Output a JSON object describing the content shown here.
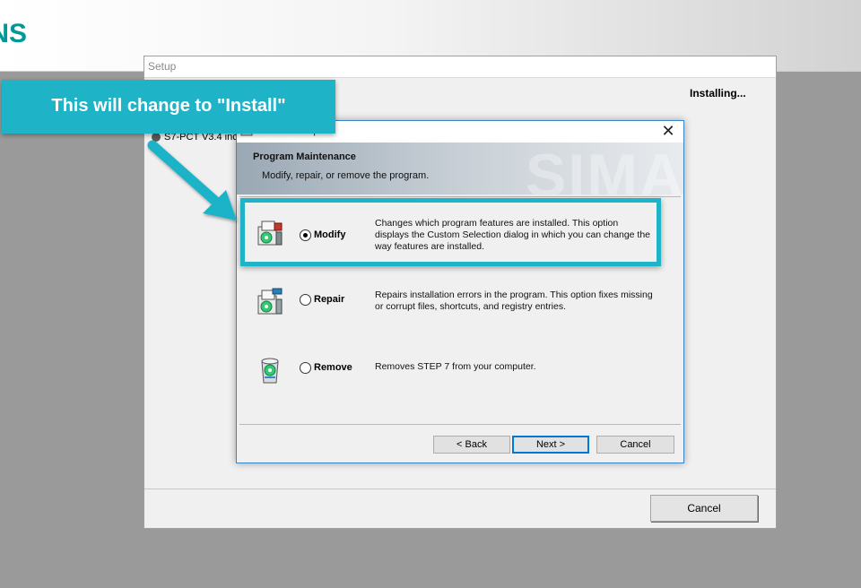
{
  "banner": {
    "logo_text": "SIEMENS"
  },
  "setup_window": {
    "title": "Setup",
    "status": "Installing...",
    "item_text": "S7-PCT V3.4 incl",
    "cancel_label": "Cancel"
  },
  "dialog": {
    "title": "STEP 7 Setup",
    "close_glyph": "✕",
    "header": {
      "watermark": "SIMA",
      "title": "Program Maintenance",
      "subtitle": "Modify, repair, or remove the program."
    },
    "options": [
      {
        "label": "Modify",
        "selected": true,
        "icon": "modify-installer-icon",
        "description": "Changes which program features are installed. This option displays the Custom Selection dialog in which you can change the way features are installed."
      },
      {
        "label": "Repair",
        "selected": false,
        "icon": "repair-installer-icon",
        "description": "Repairs installation errors in the program. This option fixes missing or corrupt files, shortcuts, and registry entries."
      },
      {
        "label": "Remove",
        "selected": false,
        "icon": "remove-recycle-icon",
        "description": "Removes STEP 7 from your computer."
      }
    ],
    "buttons": {
      "back": "< Back",
      "next": "Next >",
      "cancel": "Cancel"
    }
  },
  "annotation": {
    "callout_text": "This will change to \"Install\"",
    "color": "#1fb3c8"
  }
}
